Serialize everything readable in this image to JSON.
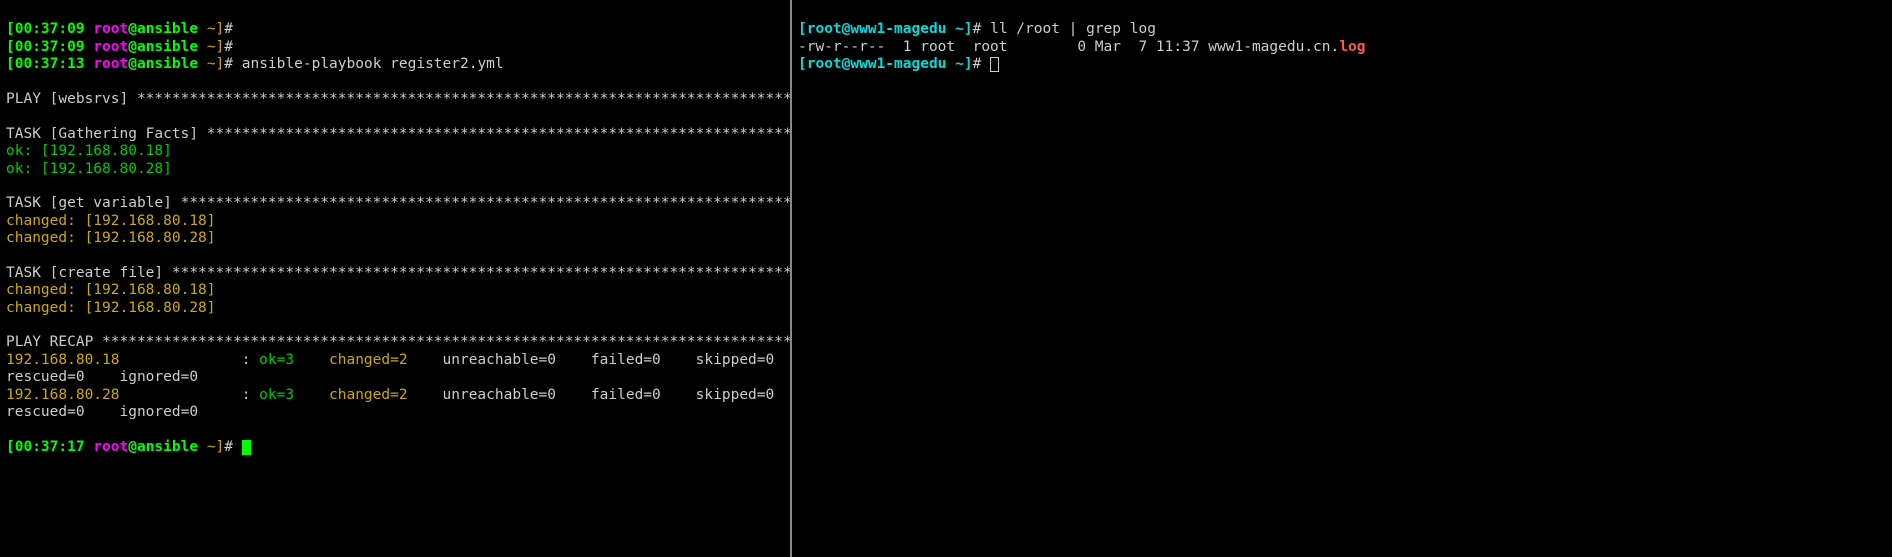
{
  "left": {
    "line1": {
      "ts": "[00:37:09 ",
      "user": "root",
      "at": "@",
      "host": "ansible ",
      "path": "~]",
      "hash": "#"
    },
    "line2": {
      "ts": "[00:37:09 ",
      "user": "root",
      "at": "@",
      "host": "ansible ",
      "path": "~]",
      "hash": "#"
    },
    "line3": {
      "ts": "[00:37:13 ",
      "user": "root",
      "at": "@",
      "host": "ansible ",
      "path": "~]",
      "hash": "#",
      "cmd": " ansible-playbook register2.yml"
    },
    "play": "PLAY [websrvs] ***************************************************************************",
    "task_gather": "TASK [Gathering Facts] *******************************************************************",
    "ok1": "ok: [192.168.80.18]",
    "ok2": "ok: [192.168.80.28]",
    "task_var": "TASK [get variable] **********************************************************************",
    "ch1": "changed: [192.168.80.18]",
    "ch2": "changed: [192.168.80.28]",
    "task_file": "TASK [create file] ***********************************************************************",
    "ch3": "changed: [192.168.80.18]",
    "ch4": "changed: [192.168.80.28]",
    "recap": "PLAY RECAP *******************************************************************************",
    "host1": "192.168.80.18              ",
    "host2": "192.168.80.28              ",
    "colon": ": ",
    "ok": "ok=3   ",
    "chg": " changed=2   ",
    "unr": " unreachable=0   ",
    "fail": " failed=0   ",
    "skip": " skipped=0   ",
    "resc": "rescued=0    ignored=0",
    "last": {
      "ts": "[00:37:17 ",
      "user": "root",
      "at": "@",
      "host": "ansible ",
      "path": "~]",
      "hash": "# "
    }
  },
  "right": {
    "p1": {
      "b1": "[root",
      "at": "@",
      "host": "www1-magedu ",
      "path": "~]",
      "hash": "# ",
      "cmd": "ll /root | grep log"
    },
    "ls": {
      "attrs": "-rw-r--r--  1 root  root        0 Mar  7 11:37 www1-magedu.cn.",
      "ext": "log"
    },
    "p2": {
      "b1": "[root",
      "at": "@",
      "host": "www1-magedu ",
      "path": "~]",
      "hash": "# "
    }
  }
}
